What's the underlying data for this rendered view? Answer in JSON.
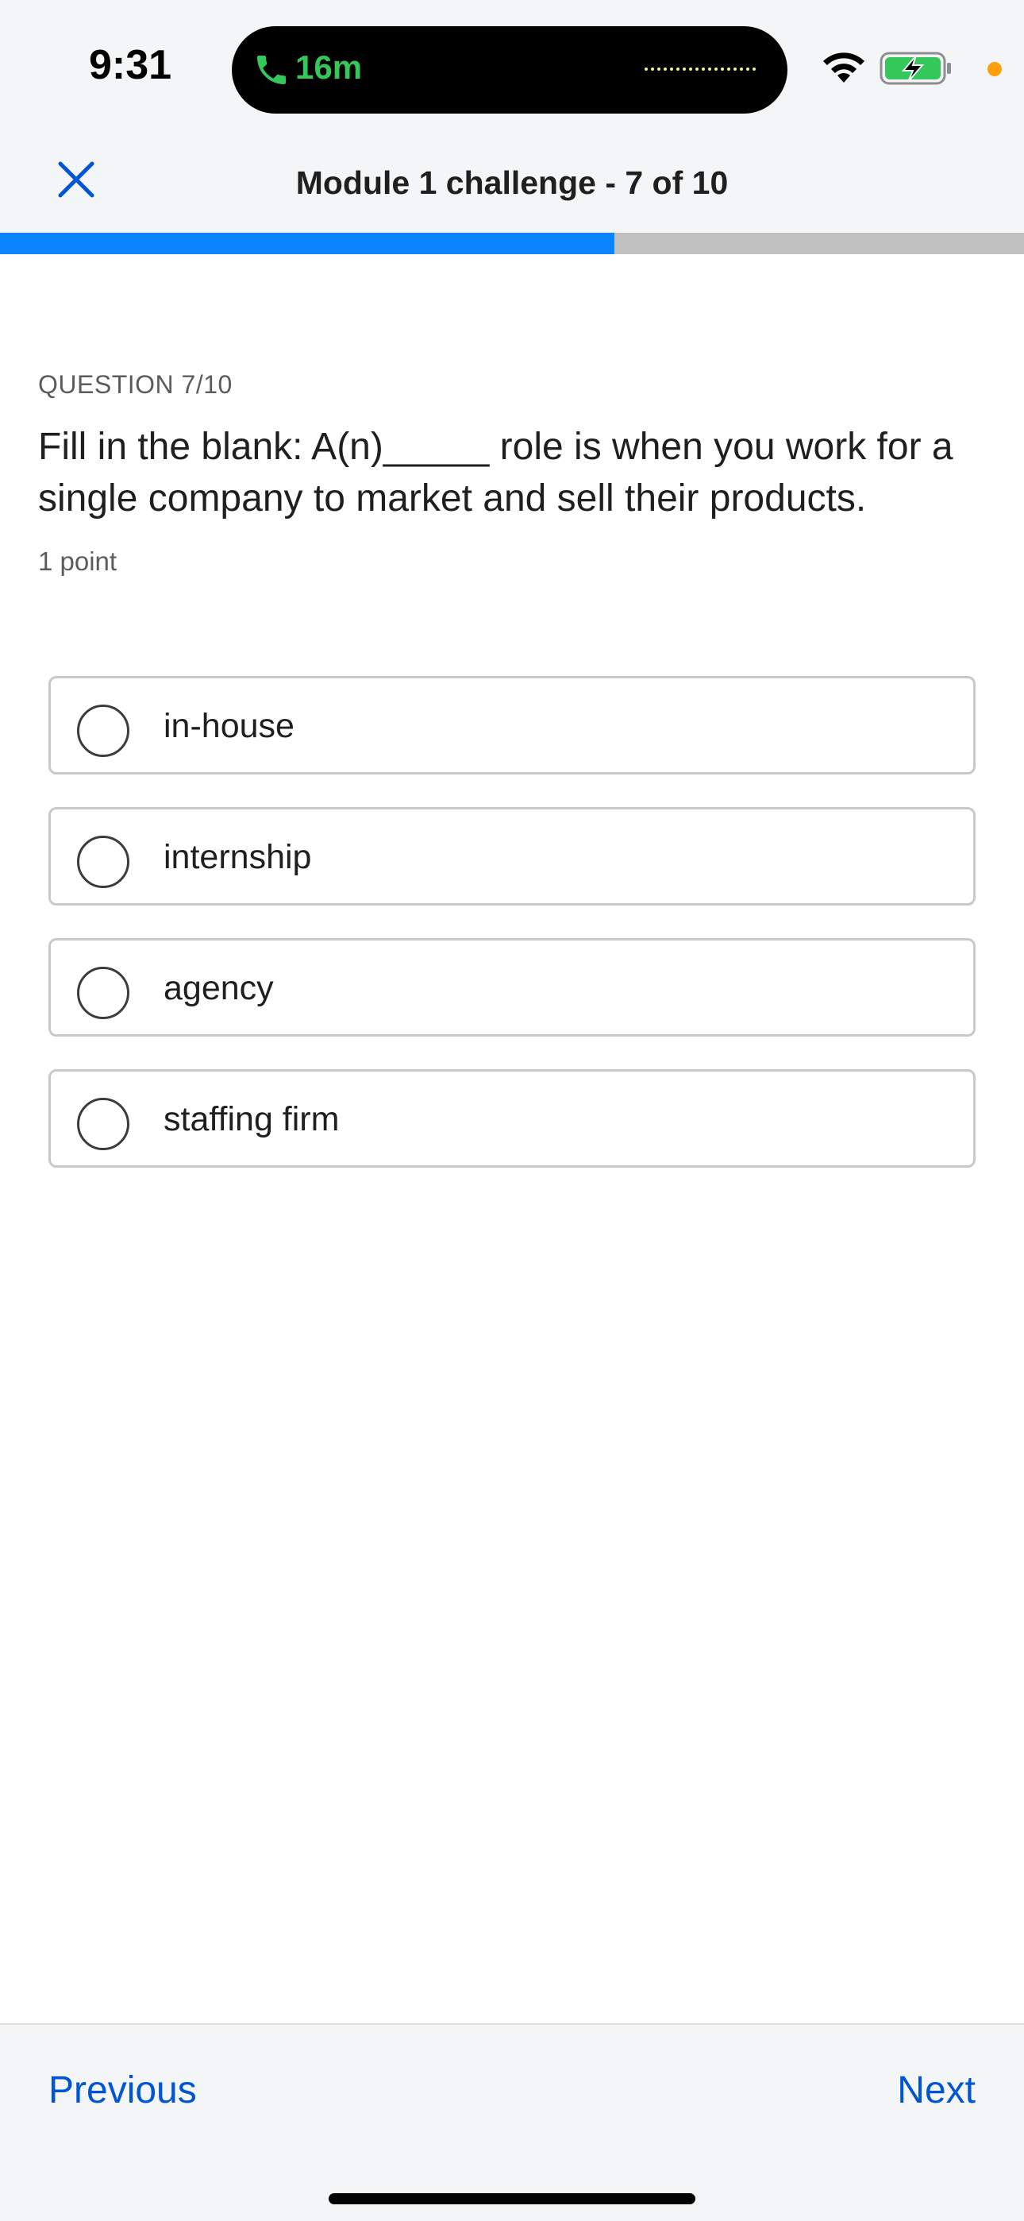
{
  "status_bar": {
    "time": "9:31",
    "call_duration": "16m",
    "accent_call": "#34c759",
    "privacy_dot_color": "#ff9f0a"
  },
  "header": {
    "title": "Module 1 challenge  - 7 of 10",
    "close_icon": "close-icon"
  },
  "progress": {
    "current": 7,
    "total": 10,
    "fraction": 0.6,
    "fill_color": "#0a84ff",
    "track_color": "#c1c1c1"
  },
  "question": {
    "counter": "QUESTION 7/10",
    "text": "Fill in the blank: A(n)_____ role is when you work for a single company to market and sell their products.",
    "points": "1 point"
  },
  "options": [
    {
      "label": "in-house",
      "selected": false
    },
    {
      "label": "internship",
      "selected": false
    },
    {
      "label": "agency",
      "selected": false
    },
    {
      "label": "staffing firm",
      "selected": false
    }
  ],
  "footer": {
    "previous_label": "Previous",
    "next_label": "Next",
    "link_color": "#0056d2"
  }
}
